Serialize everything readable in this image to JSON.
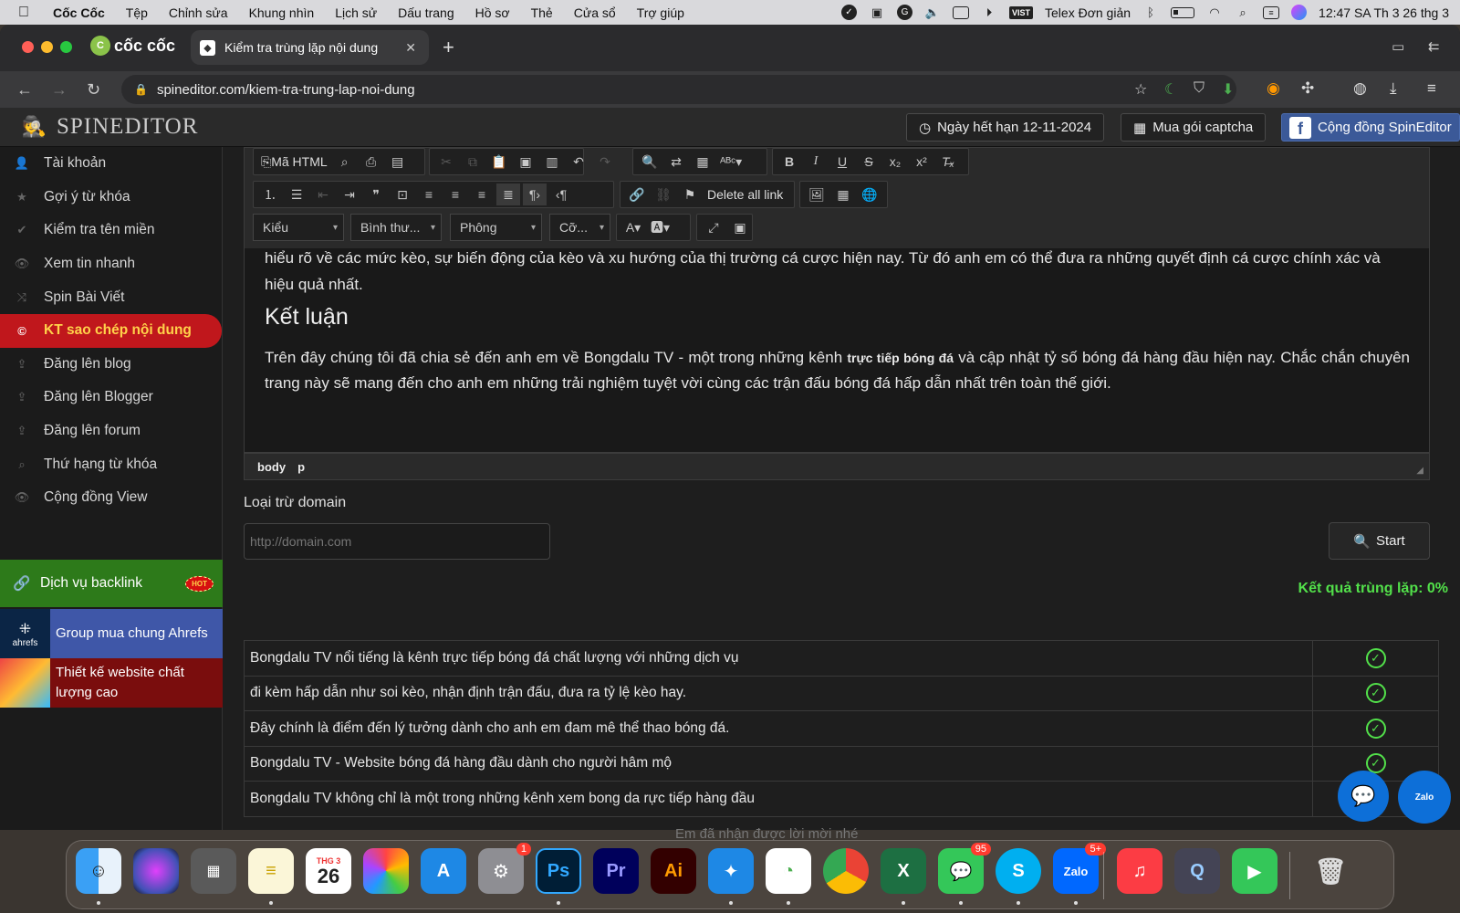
{
  "menubar": {
    "app": "Cốc Cốc",
    "items": [
      "Tệp",
      "Chỉnh sửa",
      "Khung nhìn",
      "Lịch sử",
      "Dấu trang",
      "Hồ sơ",
      "Thẻ",
      "Cửa sổ",
      "Trợ giúp"
    ],
    "input_method": "Telex Đơn giản",
    "clock": "12:47 SA Th 3 26 thg 3"
  },
  "browser": {
    "brand": "cốc cốc",
    "tab_title": "Kiểm tra trùng lặp nội dung",
    "url": "spineditor.com/kiem-tra-trung-lap-noi-dung"
  },
  "site": {
    "logo": "SPINEDITOR",
    "expiry": "Ngày hết hạn 12-11-2024",
    "captcha": "Mua gói captcha",
    "community": "Cộng đồng SpinEditor"
  },
  "sidebar": {
    "items": [
      {
        "label": "Tài khoản",
        "icon": "user-icon"
      },
      {
        "label": "Gợi ý từ khóa",
        "icon": "star-icon"
      },
      {
        "label": "Kiểm tra tên miền",
        "icon": "check-icon"
      },
      {
        "label": "Xem tin nhanh",
        "icon": "eye-icon"
      },
      {
        "label": "Spin Bài Viết",
        "icon": "shuffle-icon"
      },
      {
        "label": "KT sao chép nội dung",
        "icon": "copyright-icon",
        "active": true
      },
      {
        "label": "Đăng lên blog",
        "icon": "upload-icon"
      },
      {
        "label": "Đăng lên Blogger",
        "icon": "upload-icon"
      },
      {
        "label": "Đăng lên forum",
        "icon": "upload-icon"
      },
      {
        "label": "Thứ hạng từ khóa",
        "icon": "search-icon"
      },
      {
        "label": "Cộng đồng View",
        "icon": "eye-icon"
      }
    ],
    "backlink": "Dịch vụ backlink",
    "hot": "HOT",
    "ahrefs_logo": "ahrefs",
    "ahrefs": "Group mua chung Ahrefs",
    "web": "Thiết kế website chất lượng cao"
  },
  "toolbar": {
    "html": "Mã HTML",
    "delete_links": "Delete all link",
    "style": "Kiểu",
    "format": "Bình thư...",
    "font": "Phông",
    "size": "Cỡ..."
  },
  "editor": {
    "prev_text": "hiểu rõ về các mức kèo, sự biến động của kèo và xu hướng của thị trường cá cược hiện nay. Từ đó anh em có thể đưa ra những quyết định cá cược chính xác và hiệu quả nhất.",
    "heading": "Kết luận",
    "para_a": "Trên đây chúng tôi đã chia sẻ đến anh em về Bongdalu TV - một trong những kênh ",
    "para_bold": "trực tiếp bóng đá",
    "para_b": " và cập nhật tỷ số bóng đá hàng đầu hiện nay. Chắc chắn chuyên trang này sẽ mang đến cho anh em những trải nghiệm tuyệt vời cùng các trận đấu bóng đá hấp dẫn nhất trên toàn thế giới.",
    "path_body": "body",
    "path_p": "p"
  },
  "form": {
    "exclude_label": "Loại trừ domain",
    "placeholder": "http://domain.com",
    "start": "Start",
    "result": "Kết quả trùng lặp: 0%"
  },
  "results": [
    "Bongdalu TV nổi tiếng là kênh trực tiếp bóng đá chất lượng với những dịch vụ",
    "đi kèm hấp dẫn như soi kèo, nhận định trận đấu, đưa ra tỷ lệ kèo hay.",
    "Đây chính là điểm đến lý tưởng dành cho anh em đam mê thể thao bóng đá.",
    "Bongdalu TV - Website bóng đá hàng đầu dành cho người hâm mộ",
    "Bongdalu TV không chỉ là một trong những kênh  xem bong da rực tiếp hàng đầu"
  ],
  "behind_text": "Em đã nhận được lời mời nhé",
  "dock": {
    "calendar_month": "THG 3",
    "calendar_day": "26",
    "badge_settings": "1",
    "badge_messages": "95",
    "badge_zalo": "5+"
  },
  "zalo_label": "Zalo"
}
